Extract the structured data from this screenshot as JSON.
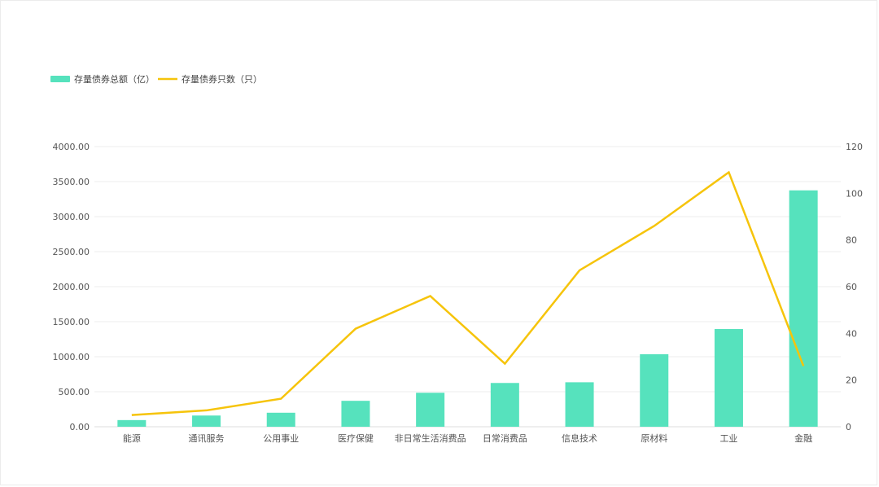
{
  "chart_data": {
    "type": "bar",
    "categories": [
      "能源",
      "通讯服务",
      "公用事业",
      "医疗保健",
      "非日常生活消费品",
      "日常消费品",
      "信息技术",
      "原材料",
      "工业",
      "金融"
    ],
    "series": [
      {
        "name": "存量债券总额（亿）",
        "type": "bar",
        "axis": "left",
        "values": [
          95,
          160,
          200,
          370,
          485,
          625,
          635,
          1035,
          1395,
          3375
        ]
      },
      {
        "name": "存量债券只数（只）",
        "type": "line",
        "axis": "right",
        "values": [
          5,
          7,
          12,
          42,
          56,
          27,
          67,
          86,
          109,
          26
        ]
      }
    ],
    "y_left": {
      "min": 0,
      "max": 4000,
      "ticks": [
        "0.00",
        "500.00",
        "1000.00",
        "1500.00",
        "2000.00",
        "2500.00",
        "3000.00",
        "3500.00",
        "4000.00"
      ]
    },
    "y_right": {
      "min": 0,
      "max": 120,
      "ticks": [
        "0",
        "20",
        "40",
        "60",
        "80",
        "100",
        "120"
      ]
    },
    "grid": true,
    "legend_position": "top-left",
    "colors": {
      "bar": "#56e2bd",
      "line": "#f6c40b",
      "grid": "#eeeeee",
      "axis": "#dddddd",
      "text": "#555555"
    }
  }
}
